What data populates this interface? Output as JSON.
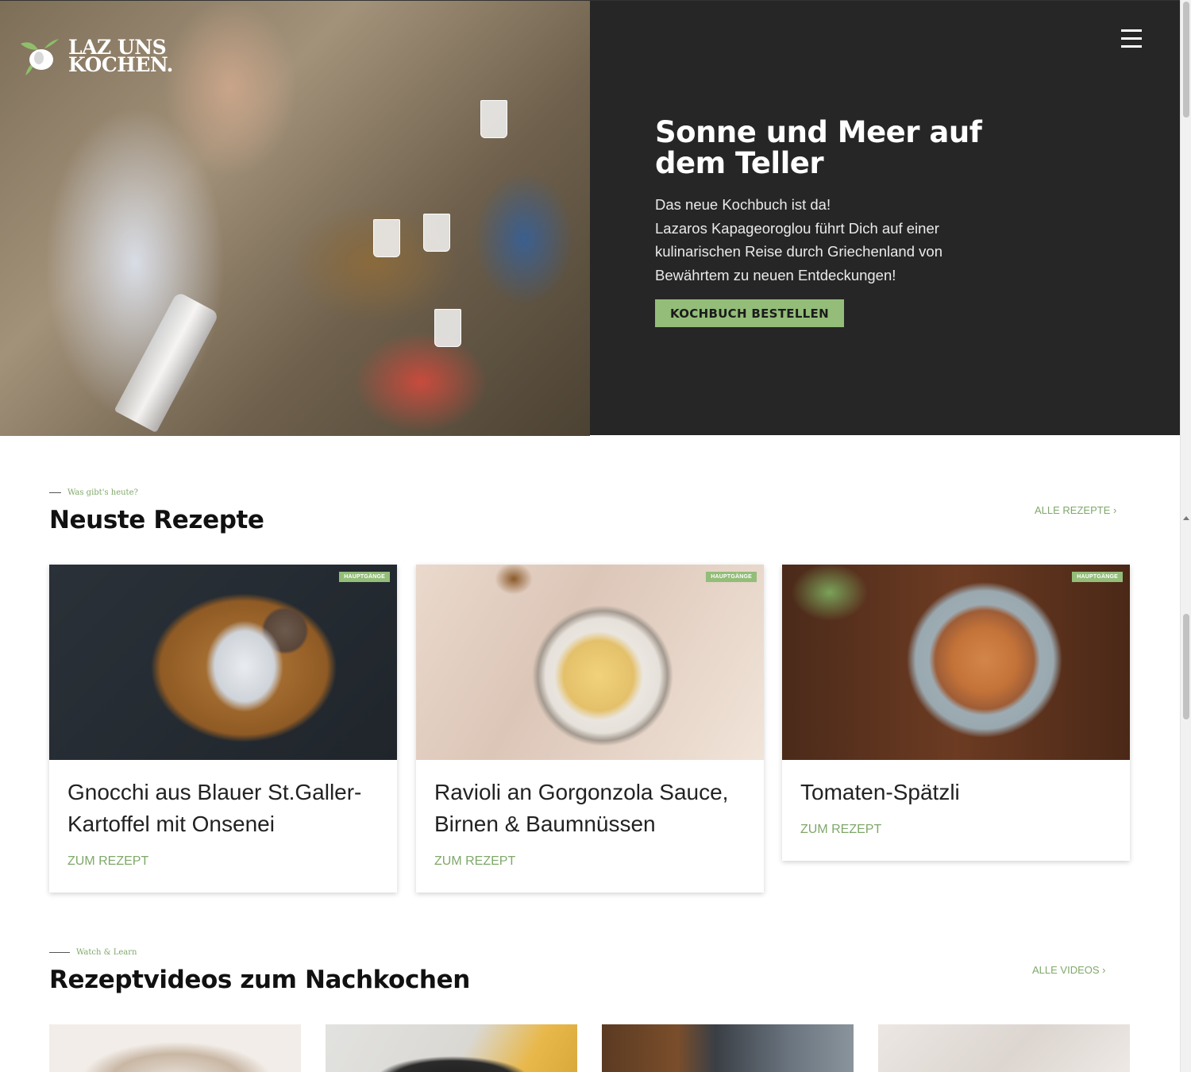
{
  "brand": {
    "logo_line1": "LAZ UNS",
    "logo_line2": "KOCHEN."
  },
  "hero": {
    "title": "Sonne und Meer auf dem Teller",
    "text_line1": "Das neue Kochbuch ist da!",
    "text_line2": "Lazaros Kapageoroglou führt Dich auf einer",
    "text_line3": "kulinarischen Reise durch Griechenland von",
    "text_line4": "Bewährtem zu neuen Entdeckungen!",
    "button_label": "KOCHBUCH BESTELLEN"
  },
  "recipes_section": {
    "eyebrow": "Was gibt's heute?",
    "title": "Neuste Rezepte",
    "all_link": "ALLE REZEPTE ›",
    "cards": [
      {
        "badge": "HAUPTGÄNGE",
        "title": "Gnocchi aus Blauer St.Galler-Kartoffel mit Onsenei",
        "link": "ZUM REZEPT"
      },
      {
        "badge": "HAUPTGÄNGE",
        "title": "Ravioli an Gorgonzola Sauce, Birnen & Baumnüssen",
        "link": "ZUM REZEPT"
      },
      {
        "badge": "HAUPTGÄNGE",
        "title": "Tomaten-Spätzli",
        "link": "ZUM REZEPT"
      }
    ]
  },
  "videos_section": {
    "eyebrow": "Watch & Learn",
    "title": "Rezeptvideos zum Nachkochen",
    "all_link": "ALLE VIDEOS ›"
  },
  "colors": {
    "accent": "#93bd78",
    "link_green": "#7fa86a",
    "hero_bg": "#262626"
  },
  "icons": {
    "menu": "hamburger-menu-icon",
    "logo": "olive-branch-logo-icon"
  }
}
